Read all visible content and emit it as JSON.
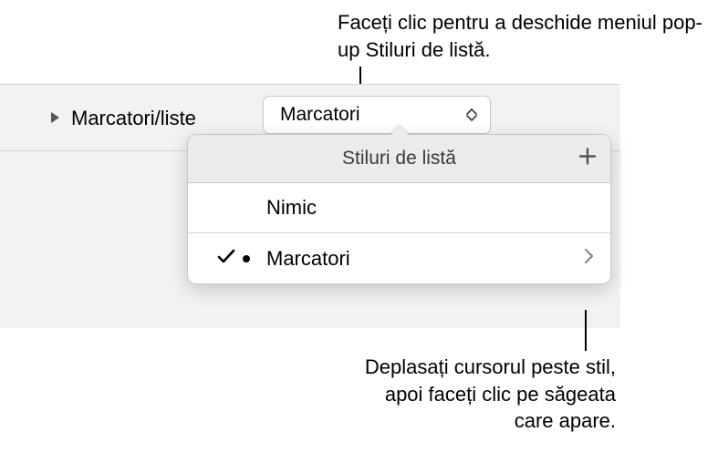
{
  "callouts": {
    "top": "Faceți clic pentru a deschide meniul pop-up Stiluri de listă.",
    "bottom": "Deplasați cursorul peste stil, apoi faceți clic pe săgeata care apare."
  },
  "panel": {
    "section_label": "Marcatori/liste",
    "dropdown_value": "Marcatori"
  },
  "popover": {
    "title": "Stiluri de listă",
    "items": {
      "none": "Nimic",
      "bullets": "Marcatori"
    }
  }
}
